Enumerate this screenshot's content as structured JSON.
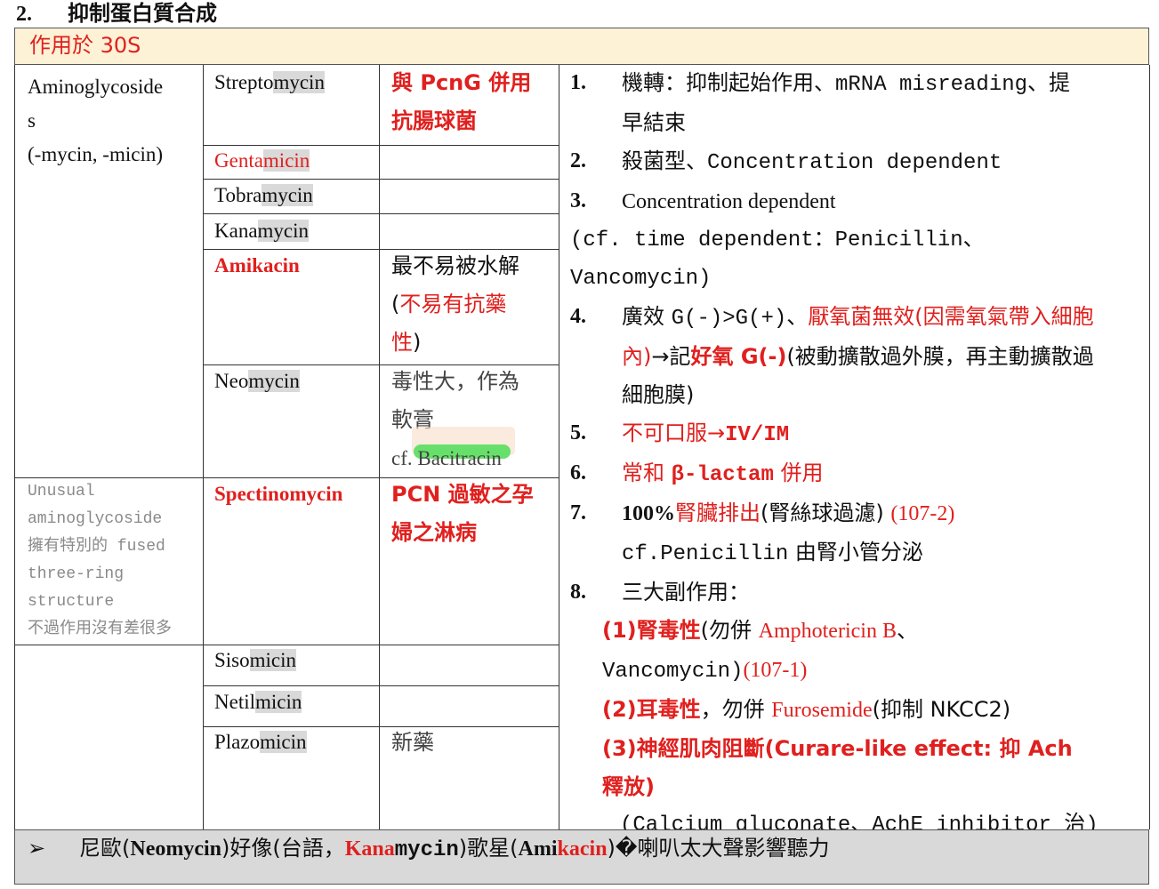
{
  "heading": {
    "number": "2.",
    "title": "抑制蛋白質合成"
  },
  "banner": "作用於 30S",
  "class_name": {
    "line1": "Aminoglycoside",
    "line2": "s",
    "line3": "(-mycin, -micin)"
  },
  "unusual": {
    "lines": [
      "Unusual",
      "aminoglycoside",
      "擁有特別的 fused",
      "three-ring",
      "structure",
      "不過作用沒有差很多"
    ]
  },
  "drugs": [
    {
      "prefix": "Strepto",
      "stem": "mycin",
      "note": ""
    },
    {
      "prefix": "Genta",
      "stem": "micin",
      "note": ""
    },
    {
      "prefix": "Tobra",
      "stem": "mycin",
      "note": ""
    },
    {
      "prefix": "Kana",
      "stem": "mycin",
      "note": ""
    },
    {
      "name": "Amikacin"
    },
    {
      "prefix": "Neo",
      "stem": "mycin"
    },
    {
      "name": "Spectinomycin"
    },
    {
      "prefix": "Siso",
      "stem": "micin"
    },
    {
      "prefix": "Netil",
      "stem": "micin"
    },
    {
      "prefix": "Plazo",
      "stem": "micin"
    }
  ],
  "notes": {
    "streptomycin": {
      "l1": "與 PcnG 併用",
      "l2": "抗腸球菌"
    },
    "amikacin": {
      "l1": "最不易被水解",
      "l2a": "(",
      "l2b": "不易有抗藥",
      "l3a": "性",
      "l3b": ")"
    },
    "neomycin": {
      "l1": "毒性大，作為",
      "l2": "軟膏",
      "l3a": "cf. ",
      "l3b": "Bacitracin"
    },
    "spectinomycin": {
      "l1": "PCN 過敏之孕",
      "l2": "婦之淋病"
    },
    "plazomicin": "新藥"
  },
  "right": {
    "i1": {
      "n": "1.",
      "a": "機轉：抑制起始作用、",
      "b": "mRNA misreading",
      "c": "、提",
      "d": "早結束"
    },
    "i2": {
      "n": "2.",
      "a": "殺菌型、",
      "b": "Concentration dependent"
    },
    "i3": {
      "n": "3.",
      "a": "Concentration dependent"
    },
    "i3x": {
      "a": "(cf. time dependent：Penicillin、",
      "b": "Vancomycin)"
    },
    "i4": {
      "n": "4.",
      "a": "廣效 ",
      "b": "G(-)>G(+)",
      "c": "、",
      "d": "厭氧菌無效(因需氧氣帶入細胞",
      "e": "內)",
      "f": "→記",
      "g": "好氧 G(-)",
      "h": "(被動擴散過外膜，再主動擴散過",
      "i": "細胞膜)"
    },
    "i5": {
      "n": "5.",
      "a": "不可口服→",
      "b": "IV/IM"
    },
    "i6": {
      "n": "6.",
      "a": "常和 ",
      "b": "β-lactam",
      "c": " 併用"
    },
    "i7": {
      "n": "7.",
      "a": "100%",
      "b": "腎臟排出",
      "c": "(腎絲球過濾) ",
      "d": "(107-2)",
      "e": "cf.Penicillin",
      "f": " 由腎小管分泌"
    },
    "i8": {
      "n": "8.",
      "a": "三大副作用："
    },
    "s1": {
      "a": "(1)腎毒性",
      "b": "(勿併 ",
      "c": "Amphotericin B",
      "d": "、",
      "e": "Vancomycin)",
      "f": "(107-1)"
    },
    "s2": {
      "a": "(2)耳毒性",
      "b": "，勿併 ",
      "c": "Furosemide",
      "d": "(抑制 NKCC2)"
    },
    "s3": {
      "a": "(3)神經肌肉阻斷(Curare-like effect: 抑 Ach",
      "b": "釋放)"
    },
    "s4": "(Calcium gluconate、AchE inhibitor 治)"
  },
  "footer": {
    "arrow": "➢",
    "a": "尼歐(",
    "b": "Neomycin",
    "c": ")好像(台語，",
    "d": "Kana",
    "e": "mycin",
    "f": ")歌星(",
    "g": "Ami",
    "h": "kacin",
    "i": ")�喇叭太大聲影響聽力"
  }
}
